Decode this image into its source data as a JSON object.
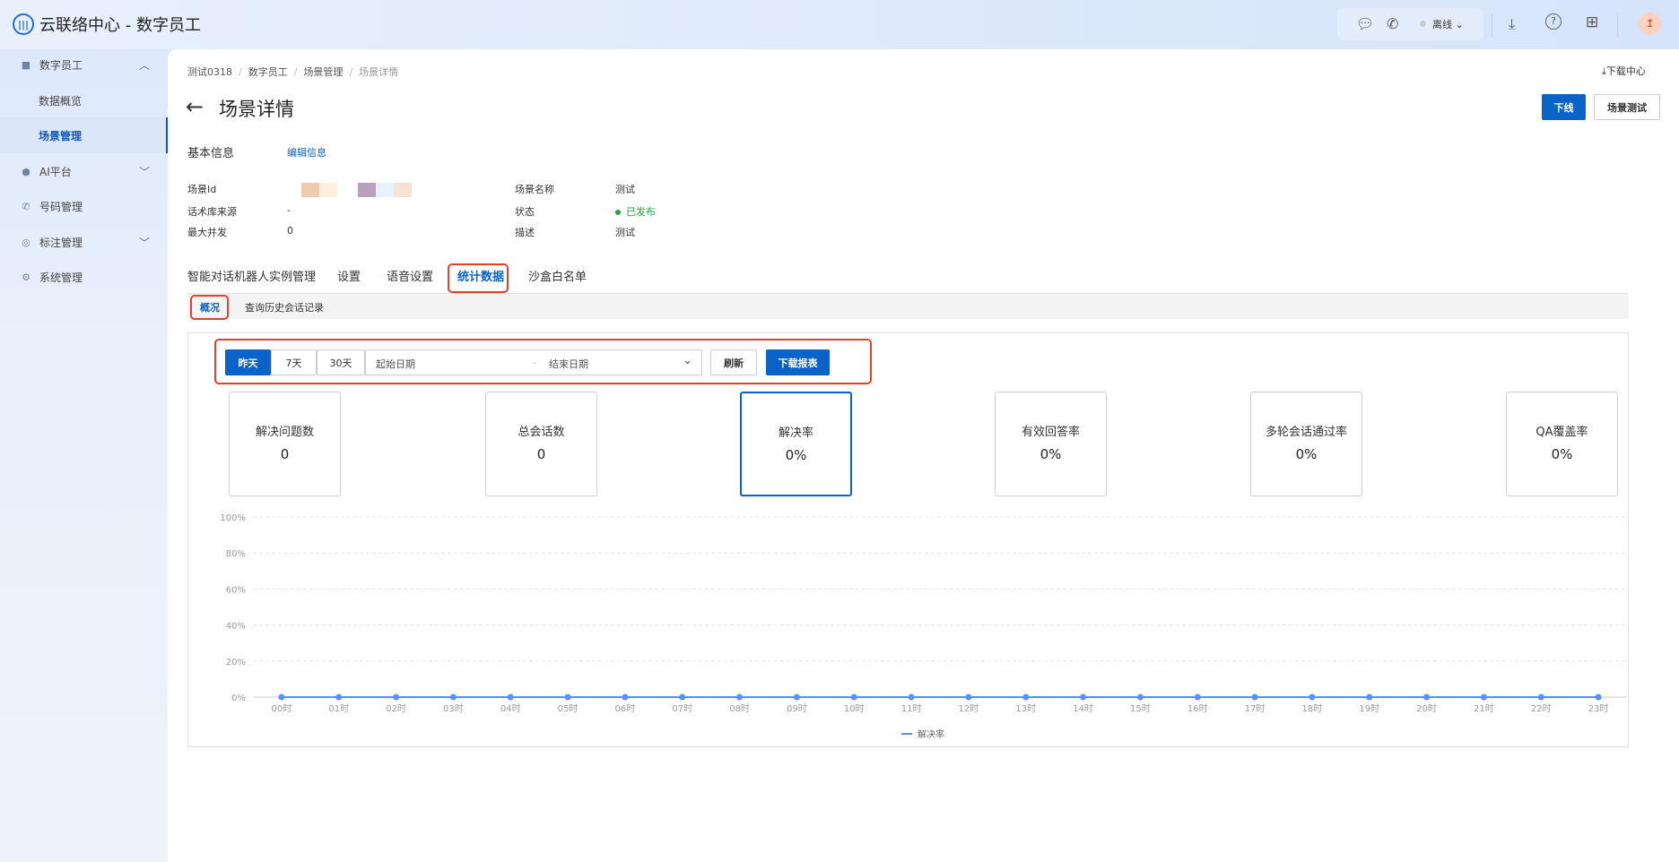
{
  "app": {
    "title": "云联络中心 - 数字员工",
    "status": "离线"
  },
  "sidebar": {
    "items": [
      {
        "label": "数字员工",
        "icon": "robot-icon",
        "expanded": true
      },
      {
        "label": "数据概览",
        "sub": true
      },
      {
        "label": "场景管理",
        "sub": true,
        "active": true
      },
      {
        "label": "AI平台",
        "icon": "ai-icon"
      },
      {
        "label": "号码管理",
        "icon": "phone-icon"
      },
      {
        "label": "标注管理",
        "icon": "tag-icon"
      },
      {
        "label": "系统管理",
        "icon": "gear-icon"
      }
    ]
  },
  "breadcrumb": [
    "测试0318",
    "数字员工",
    "场景管理",
    "场景详情"
  ],
  "download_center": "下载中心",
  "page_title": "场景详情",
  "actions": {
    "offline": "下线",
    "test": "场景测试"
  },
  "basic": {
    "title": "基本信息",
    "edit": "编辑信息",
    "fields": [
      {
        "label": "场景Id",
        "value": ""
      },
      {
        "label": "话术库来源",
        "value": "-"
      },
      {
        "label": "最大并发",
        "value": "0"
      },
      {
        "label": "场景名称",
        "value": "测试"
      },
      {
        "label": "状态",
        "value": "已发布"
      },
      {
        "label": "描述",
        "value": "测试"
      }
    ]
  },
  "tabs": [
    "智能对话机器人实例管理",
    "设置",
    "语音设置",
    "统计数据",
    "沙盒白名单"
  ],
  "subtabs": [
    "概况",
    "查询历史会话记录"
  ],
  "filter": {
    "ranges": [
      "昨天",
      "7天",
      "30天"
    ],
    "start_placeholder": "起始日期",
    "sep": "-",
    "end_placeholder": "结束日期",
    "refresh": "刷新",
    "download": "下载报表"
  },
  "cards": [
    {
      "title": "解决问题数",
      "value": "0"
    },
    {
      "title": "总会话数",
      "value": "0"
    },
    {
      "title": "解决率",
      "value": "0%"
    },
    {
      "title": "有效回答率",
      "value": "0%"
    },
    {
      "title": "多轮会话通过率",
      "value": "0%"
    },
    {
      "title": "QA覆盖率",
      "value": "0%"
    }
  ],
  "chart_data": {
    "type": "line",
    "title": "",
    "xlabel": "",
    "ylabel": "",
    "categories": [
      "00时",
      "01时",
      "02时",
      "03时",
      "04时",
      "05时",
      "06时",
      "07时",
      "08时",
      "09时",
      "10时",
      "11时",
      "12时",
      "13时",
      "14时",
      "15时",
      "16时",
      "17时",
      "18时",
      "19时",
      "20时",
      "21时",
      "22时",
      "23时"
    ],
    "yticks": [
      "0%",
      "20%",
      "40%",
      "60%",
      "80%",
      "100%"
    ],
    "ylim": [
      0,
      100
    ],
    "series": [
      {
        "name": "解决率",
        "color": "#5b8ff9",
        "values": [
          0,
          0,
          0,
          0,
          0,
          0,
          0,
          0,
          0,
          0,
          0,
          0,
          0,
          0,
          0,
          0,
          0,
          0,
          0,
          0,
          0,
          0,
          0,
          0
        ]
      }
    ],
    "legend": "bottom",
    "grid": true
  }
}
